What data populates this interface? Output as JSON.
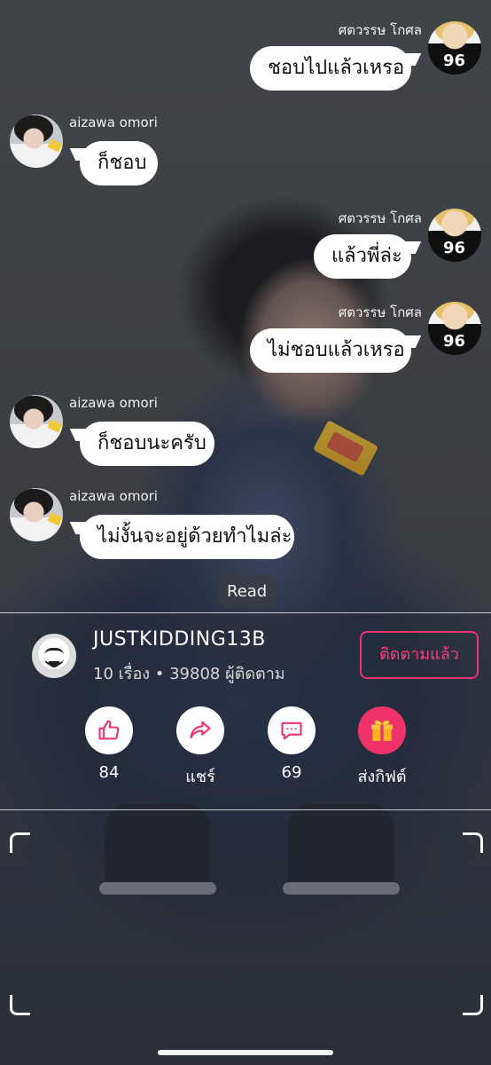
{
  "chat": {
    "messages": [
      {
        "side": "right",
        "sender": "ศตวรรษ โกศล",
        "text": "ชอบไปแล้วเหรอ"
      },
      {
        "side": "left",
        "sender": "aizawa omori",
        "text": "ก็ชอบ"
      },
      {
        "side": "right",
        "sender": "ศตวรรษ โกศล",
        "text": "แล้วพี่ล่ะ"
      },
      {
        "side": "right",
        "sender": "ศตวรรษ โกศล",
        "text": "ไม่ชอบแล้วเหรอ"
      },
      {
        "side": "left",
        "sender": "aizawa omori",
        "text": "ก็ชอบนะครับ"
      },
      {
        "side": "left",
        "sender": "aizawa omori",
        "text": "ไม่งั้นจะอยู่ด้วยทำไมล่ะ"
      }
    ],
    "read_label": "Read"
  },
  "author": {
    "name": "JUSTKIDDING13B",
    "stats": "10 เรื่อง • 39808 ผู้ติดตาม",
    "follow_label": "ติดตามแล้ว"
  },
  "actions": {
    "like": {
      "icon": "thumbs-up-icon",
      "label": "84"
    },
    "share": {
      "icon": "share-arrow-icon",
      "label": "แชร์"
    },
    "comment": {
      "icon": "comment-icon",
      "label": "69"
    },
    "gift": {
      "icon": "gift-icon",
      "label": "ส่งกิฟต์"
    }
  },
  "colors": {
    "accent": "#f0326a",
    "bubble": "#ffffff",
    "icon_pink": "#e8346f"
  }
}
